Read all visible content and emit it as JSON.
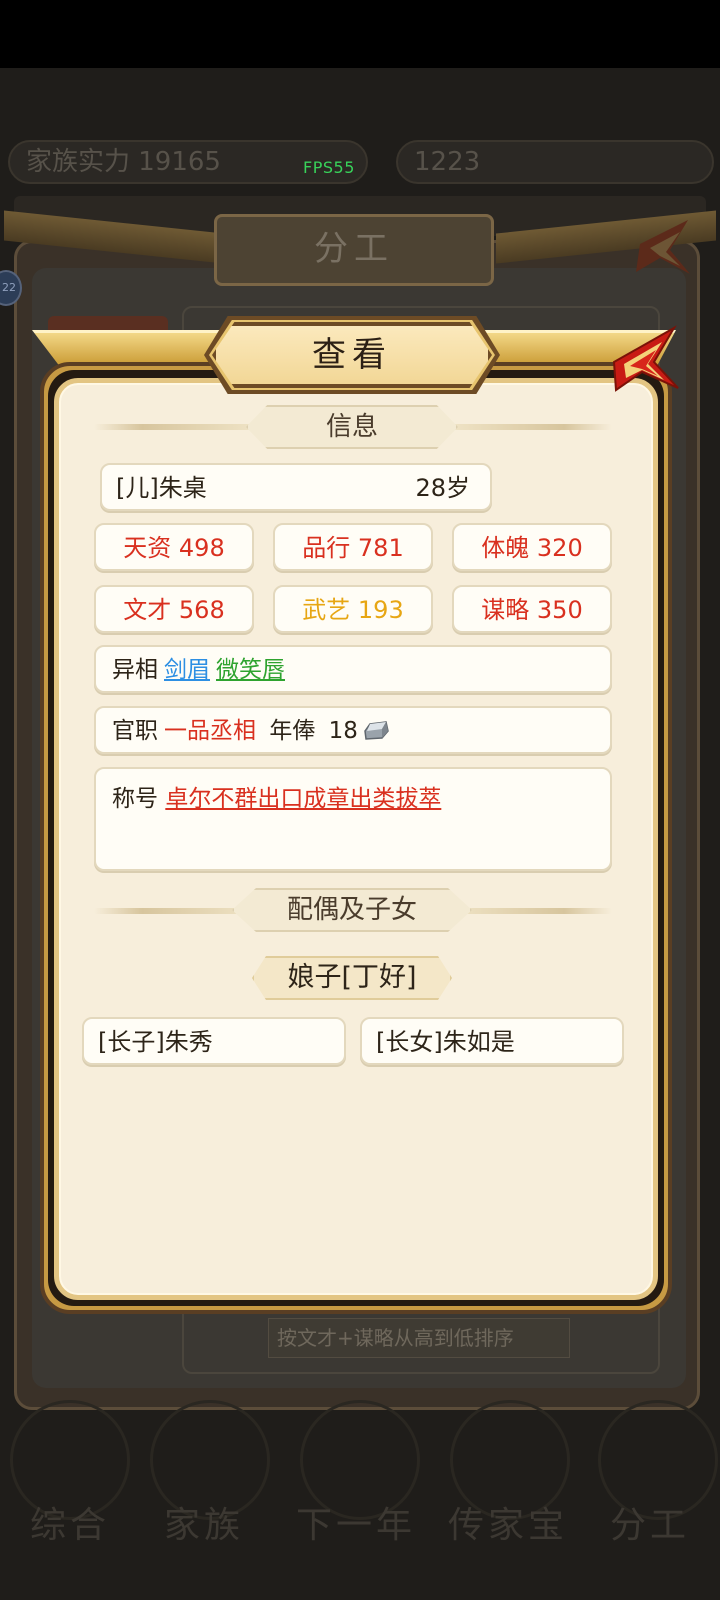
{
  "status": {
    "fps": "FPS55"
  },
  "background": {
    "stat_left": "家族实力  19165",
    "stat_right": "1223",
    "badge": "22",
    "title": "分工",
    "sort_label": "按文才+谋略从高到低排序",
    "nav": [
      "综合",
      "家族",
      "下一年",
      "传家宝",
      "分工"
    ]
  },
  "dialog": {
    "title": "查看",
    "info_header": "信息",
    "person": {
      "name": "[儿]朱桌",
      "age": "28岁"
    },
    "stats": [
      {
        "label": "天资",
        "value": "498",
        "color": "#d9301f"
      },
      {
        "label": "品行",
        "value": "781",
        "color": "#d9301f"
      },
      {
        "label": "体魄",
        "value": "320",
        "color": "#d9301f"
      },
      {
        "label": "文才",
        "value": "568",
        "color": "#d9301f"
      },
      {
        "label": "武艺",
        "value": "193",
        "color": "#e7a613"
      },
      {
        "label": "谋略",
        "value": "350",
        "color": "#d9301f"
      }
    ],
    "traits": {
      "label": "异相",
      "items": [
        "剑眉",
        "微笑唇"
      ]
    },
    "office": {
      "label": "官职",
      "value": "一品丞相",
      "salary_label": "年俸",
      "salary": "18",
      "salary_icon": "silver-ingot-icon"
    },
    "honor": {
      "label": "称号",
      "value": "卓尔不群出口成章出类拔萃"
    },
    "family_header": "配偶及子女",
    "spouse": "娘子[丁好]",
    "children": [
      "[长子]朱秀",
      "[长女]朱如是"
    ]
  }
}
